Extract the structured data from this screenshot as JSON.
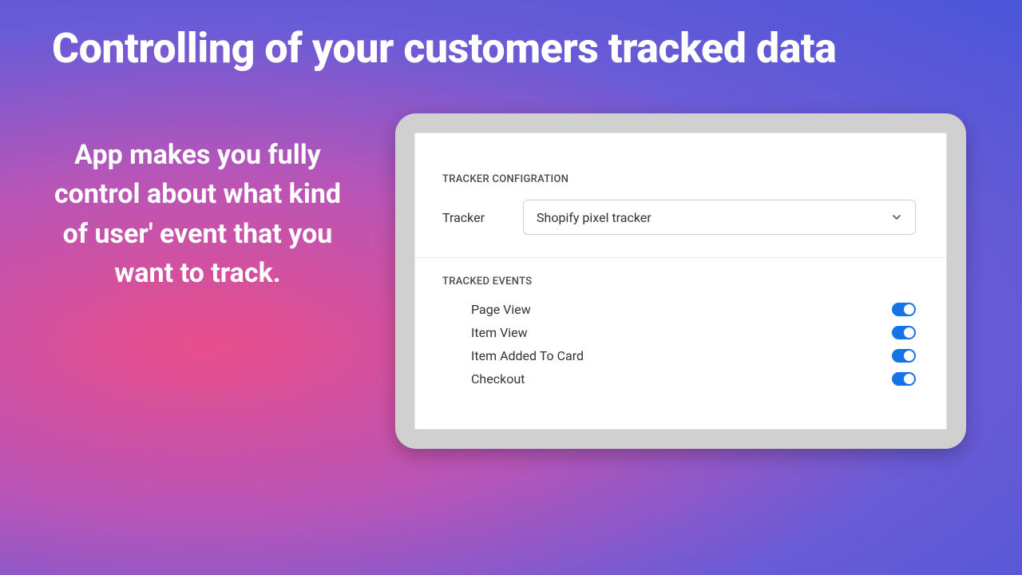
{
  "heading": "Controlling of your customers tracked data",
  "subheading": "App makes you fully control about what kind of user' event that you want to track.",
  "panel": {
    "section_config_label": "TRACKER CONFIGRATION",
    "tracker_label": "Tracker",
    "tracker_value": "Shopify pixel tracker",
    "section_events_label": "TRACKED EVENTS",
    "events": [
      {
        "label": "Page View",
        "enabled": true
      },
      {
        "label": "Item View",
        "enabled": true
      },
      {
        "label": "Item Added To Card",
        "enabled": true
      },
      {
        "label": "Checkout",
        "enabled": true
      }
    ]
  }
}
